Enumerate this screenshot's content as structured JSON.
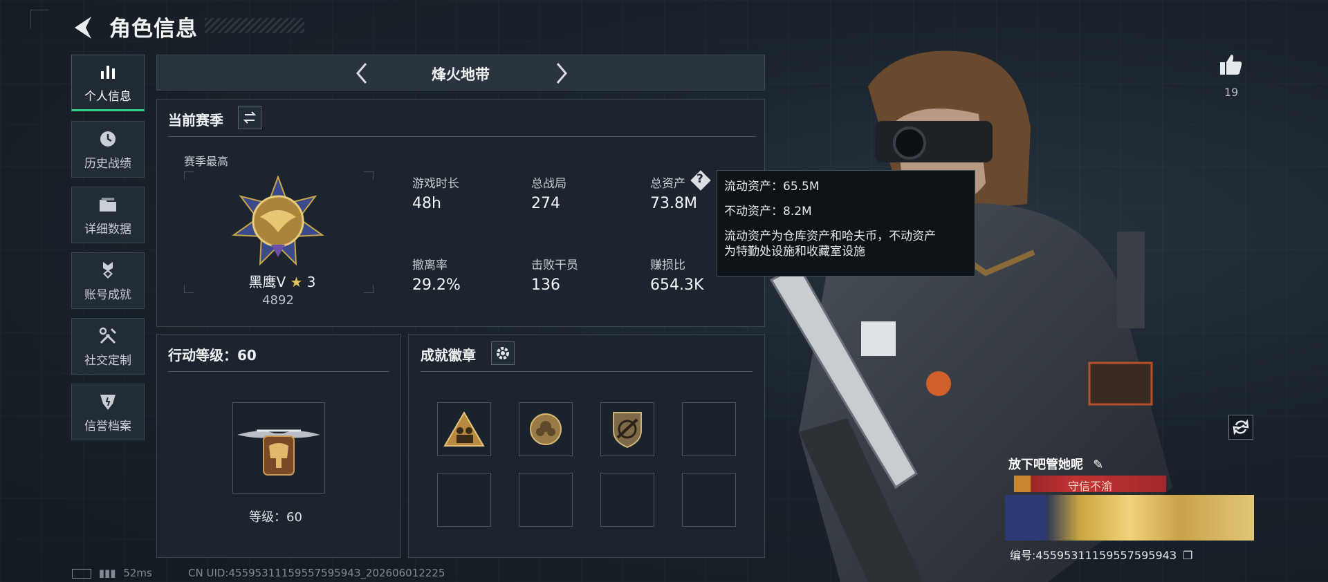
{
  "header": {
    "title": "角色信息"
  },
  "sidebar": {
    "items": [
      {
        "label": "个人信息",
        "icon": "bar-chart-icon",
        "active": true
      },
      {
        "label": "历史战绩",
        "icon": "clock-icon"
      },
      {
        "label": "详细数据",
        "icon": "folder-icon"
      },
      {
        "label": "账号成就",
        "icon": "medal-icon"
      },
      {
        "label": "社交定制",
        "icon": "wrench-icon"
      },
      {
        "label": "信誉档案",
        "icon": "shield-icon"
      }
    ]
  },
  "mode": {
    "name": "烽火地带"
  },
  "season": {
    "title": "当前赛季",
    "best_label": "赛季最高",
    "rank_name": "黑鹰V",
    "rank_stars": "3",
    "rank_score": "4892",
    "stats": [
      {
        "label": "游戏时长",
        "value": "48h"
      },
      {
        "label": "总战局",
        "value": "274"
      },
      {
        "label": "总资产",
        "value": "73.8M"
      },
      {
        "label": "撤离率",
        "value": "29.2%"
      },
      {
        "label": "击败干员",
        "value": "136"
      },
      {
        "label": "赚损比",
        "value": "654.3K"
      }
    ]
  },
  "tooltip": {
    "liquid": "流动资产：65.5M",
    "fixed": "不动资产：8.2M",
    "desc_line1": "流动资产为仓库资产和哈夫币，不动资产",
    "desc_line2": "为特勤处设施和收藏室设施"
  },
  "action_level": {
    "title": "行动等级：60",
    "level_label": "等级：60"
  },
  "badges": {
    "title": "成就徽章",
    "slots": [
      "triangle-badge",
      "rose-badge",
      "rifle-shield-badge",
      "",
      "",
      "",
      "",
      ""
    ]
  },
  "profile": {
    "likes": "19",
    "name": "放下吧管她呢",
    "badge": "守信不渝",
    "id": "编号:4559531115955759594З"
  },
  "footer": {
    "ping": "52ms",
    "uid": "CN UID:4559531115955759594З_202606012225"
  },
  "colors": {
    "accent": "#2fd38a",
    "panel": "#1c252e",
    "border": "#3a4650"
  }
}
